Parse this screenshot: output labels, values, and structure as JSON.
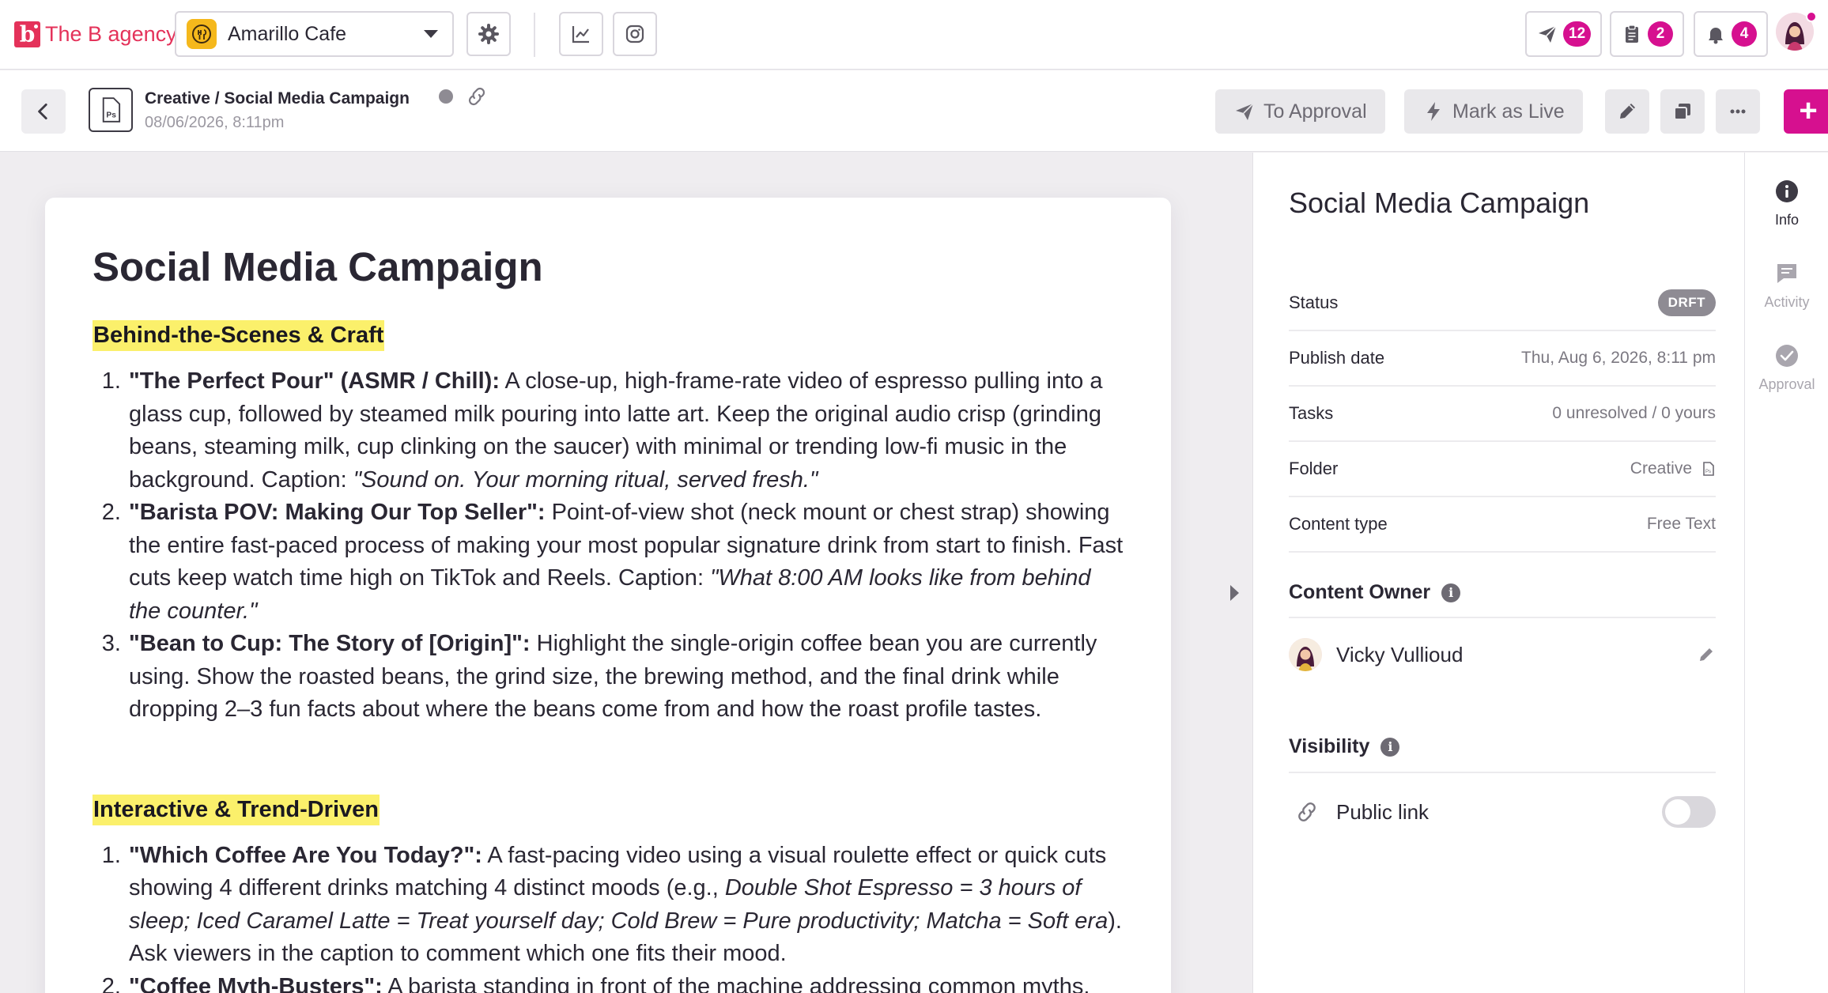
{
  "agency": {
    "logo_letter": "b",
    "name": "The B agency"
  },
  "brand": {
    "name": "Amarillo Cafe"
  },
  "topbar": {
    "sends_count": "12",
    "tasks_count": "2",
    "notifications_count": "4"
  },
  "doc_header": {
    "path": "Creative / Social Media Campaign",
    "date": "08/06/2026, 8:11pm",
    "to_approval_label": "To Approval",
    "mark_live_label": "Mark as Live",
    "add_label": "+"
  },
  "document": {
    "title": "Social Media Campaign",
    "sections": [
      {
        "heading": "Behind-the-Scenes & Craft",
        "items": [
          {
            "lead": "\"The Perfect Pour\" (ASMR / Chill):",
            "body": " A close-up, high-frame-rate video of espresso pulling into a glass cup, followed by steamed milk pouring into latte art. Keep the original audio crisp (grinding beans, steaming milk, cup clinking on the saucer) with minimal or trending low-fi music in the background. Caption: ",
            "caption": "\"Sound on. Your morning ritual, served fresh.\"",
            "tail": ""
          },
          {
            "lead": "\"Barista POV: Making Our Top Seller\":",
            "body": " Point-of-view shot (neck mount or chest strap) showing the entire fast-paced process of making your most popular signature drink from start to finish. Fast cuts keep watch time high on TikTok and Reels. Caption: ",
            "caption": "\"What 8:00 AM looks like from behind the counter.\"",
            "tail": ""
          },
          {
            "lead": "\"Bean to Cup: The Story of [Origin]\":",
            "body": " Highlight the single-origin coffee bean you are currently using. Show the roasted beans, the grind size, the brewing method, and the final drink while dropping 2–3 fun facts about where the beans come from and how the roast profile tastes.",
            "caption": "",
            "tail": ""
          }
        ]
      },
      {
        "heading": "Interactive & Trend-Driven",
        "items": [
          {
            "lead": "\"Which Coffee Are You Today?\":",
            "body": " A fast-pacing video using a visual roulette effect or quick cuts showing 4 different drinks matching 4 distinct moods (e.g., ",
            "caption": "Double Shot Espresso = 3 hours of sleep; Iced Caramel Latte = Treat yourself day; Cold Brew = Pure productivity; Matcha = Soft era",
            "tail": "). Ask viewers in the caption to comment which one fits their mood."
          },
          {
            "lead": "\"Coffee Myth-Busters\":",
            "body": " A barista standing in front of the machine addressing common myths.",
            "caption": "",
            "tail": ""
          }
        ]
      }
    ]
  },
  "info_panel": {
    "title": "Social Media Campaign",
    "rows": [
      {
        "label": "Status",
        "value": "DRFT"
      },
      {
        "label": "Publish date",
        "value": "Thu, Aug 6, 2026, 8:11 pm"
      },
      {
        "label": "Tasks",
        "value": "0 unresolved / 0 yours"
      },
      {
        "label": "Folder",
        "value": "Creative"
      },
      {
        "label": "Content type",
        "value": "Free Text"
      }
    ],
    "content_owner_title": "Content Owner",
    "owner_name": "Vicky Vullioud",
    "visibility_title": "Visibility",
    "public_link_label": "Public link",
    "public_link_enabled": false
  },
  "side_rail": {
    "items": [
      {
        "label": "Info",
        "icon": "info-icon",
        "active": true
      },
      {
        "label": "Activity",
        "icon": "comment-icon",
        "active": false
      },
      {
        "label": "Approval",
        "icon": "check-circle-icon",
        "active": false
      }
    ]
  },
  "colors": {
    "brand": "#e4325a",
    "accent": "#d6108f",
    "highlight": "#fbf06b",
    "status_draft": "#8e8b93"
  }
}
